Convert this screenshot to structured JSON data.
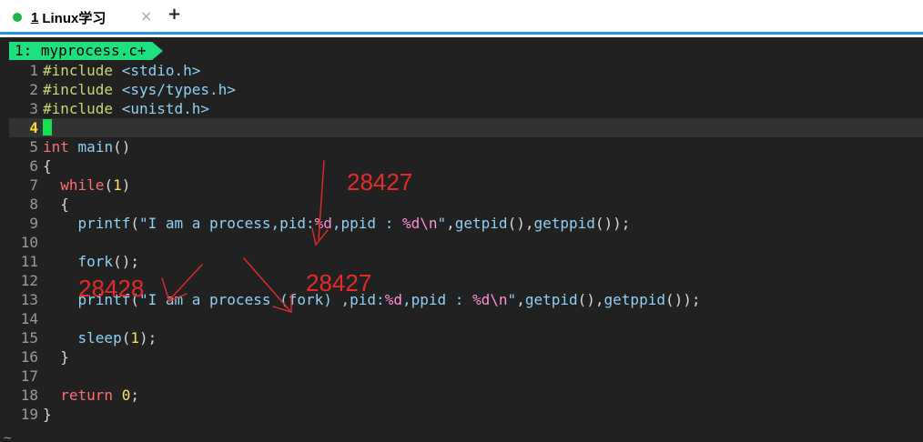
{
  "tabs": [
    {
      "number": "1",
      "label": "Linux学习",
      "active": true,
      "dot_color": "#1bb34a"
    }
  ],
  "tab_close_glyph": "×",
  "new_tab_glyph": "+",
  "buffer": {
    "index": "1:",
    "name": "myprocess.c+"
  },
  "code": [
    {
      "n": "1",
      "text": "#include <stdio.h>"
    },
    {
      "n": "2",
      "text": "#include <sys/types.h>"
    },
    {
      "n": "3",
      "text": "#include <unistd.h>"
    },
    {
      "n": "4",
      "text": ""
    },
    {
      "n": "5",
      "text": "int main()"
    },
    {
      "n": "6",
      "text": "{"
    },
    {
      "n": "7",
      "text": "  while(1)"
    },
    {
      "n": "8",
      "text": "  {"
    },
    {
      "n": "9",
      "text": "    printf(\"I am a process,pid:%d,ppid : %d\\n\",getpid(),getppid());"
    },
    {
      "n": "10",
      "text": ""
    },
    {
      "n": "11",
      "text": "    fork();"
    },
    {
      "n": "12",
      "text": ""
    },
    {
      "n": "13",
      "text": "    printf(\"I am a process (fork) ,pid:%d,ppid : %d\\n\",getpid(),getppid());"
    },
    {
      "n": "14",
      "text": ""
    },
    {
      "n": "15",
      "text": "    sleep(1);"
    },
    {
      "n": "16",
      "text": "  }"
    },
    {
      "n": "17",
      "text": ""
    },
    {
      "n": "18",
      "text": "  return 0;"
    },
    {
      "n": "19",
      "text": "}"
    }
  ],
  "current_line": "4",
  "empty_line_marker": "~",
  "annotations": [
    {
      "text": "28427"
    },
    {
      "text": "28428"
    },
    {
      "text": "28427"
    }
  ],
  "colors": {
    "accent": "#2a92e6",
    "buffer_tag": "#1ee07e",
    "annotation": "#e52a2a",
    "background": "#212121"
  }
}
